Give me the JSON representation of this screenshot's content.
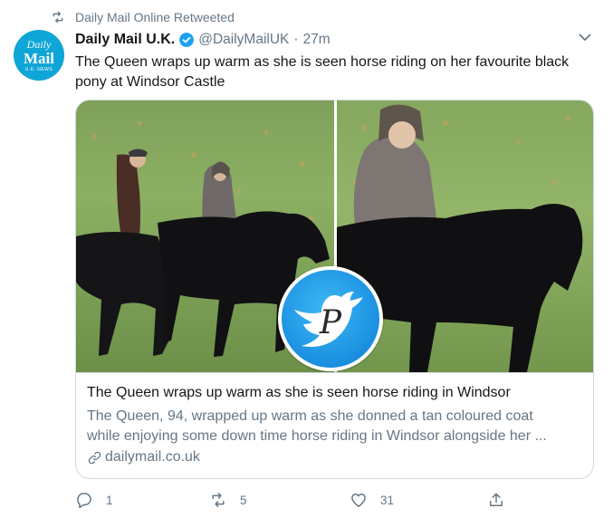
{
  "retweet": {
    "label": "Daily Mail Online Retweeted",
    "icon": "retweet-icon"
  },
  "avatar": {
    "line1": "Daily",
    "line2": "Mail",
    "line3": "U.K. NEWS",
    "color": "#0ea5d7"
  },
  "author": {
    "name": "Daily Mail U.K.",
    "handle": "@DailyMailUK",
    "separator": "·",
    "time": "27m",
    "verified_icon": "verified-badge-icon"
  },
  "tweet": {
    "text": "The Queen wraps up warm as she is seen horse riding on her favourite black pony at Windsor Castle"
  },
  "card": {
    "title": "The Queen wraps up warm as she is seen horse riding in Windsor",
    "description_line1": "The Queen, 94, wrapped up warm as she donned a tan coloured coat",
    "description_line2": "while enjoying some down time horse riding in Windsor alongside her ...",
    "domain": "dailymail.co.uk",
    "link_icon": "link-icon",
    "badge_letter": "P"
  },
  "actions": {
    "reply_count": "1",
    "retweet_count": "5",
    "like_count": "31"
  },
  "colors": {
    "accent": "#1da1f2",
    "muted": "#657786",
    "text": "#14171a",
    "border": "#cfd9de"
  }
}
